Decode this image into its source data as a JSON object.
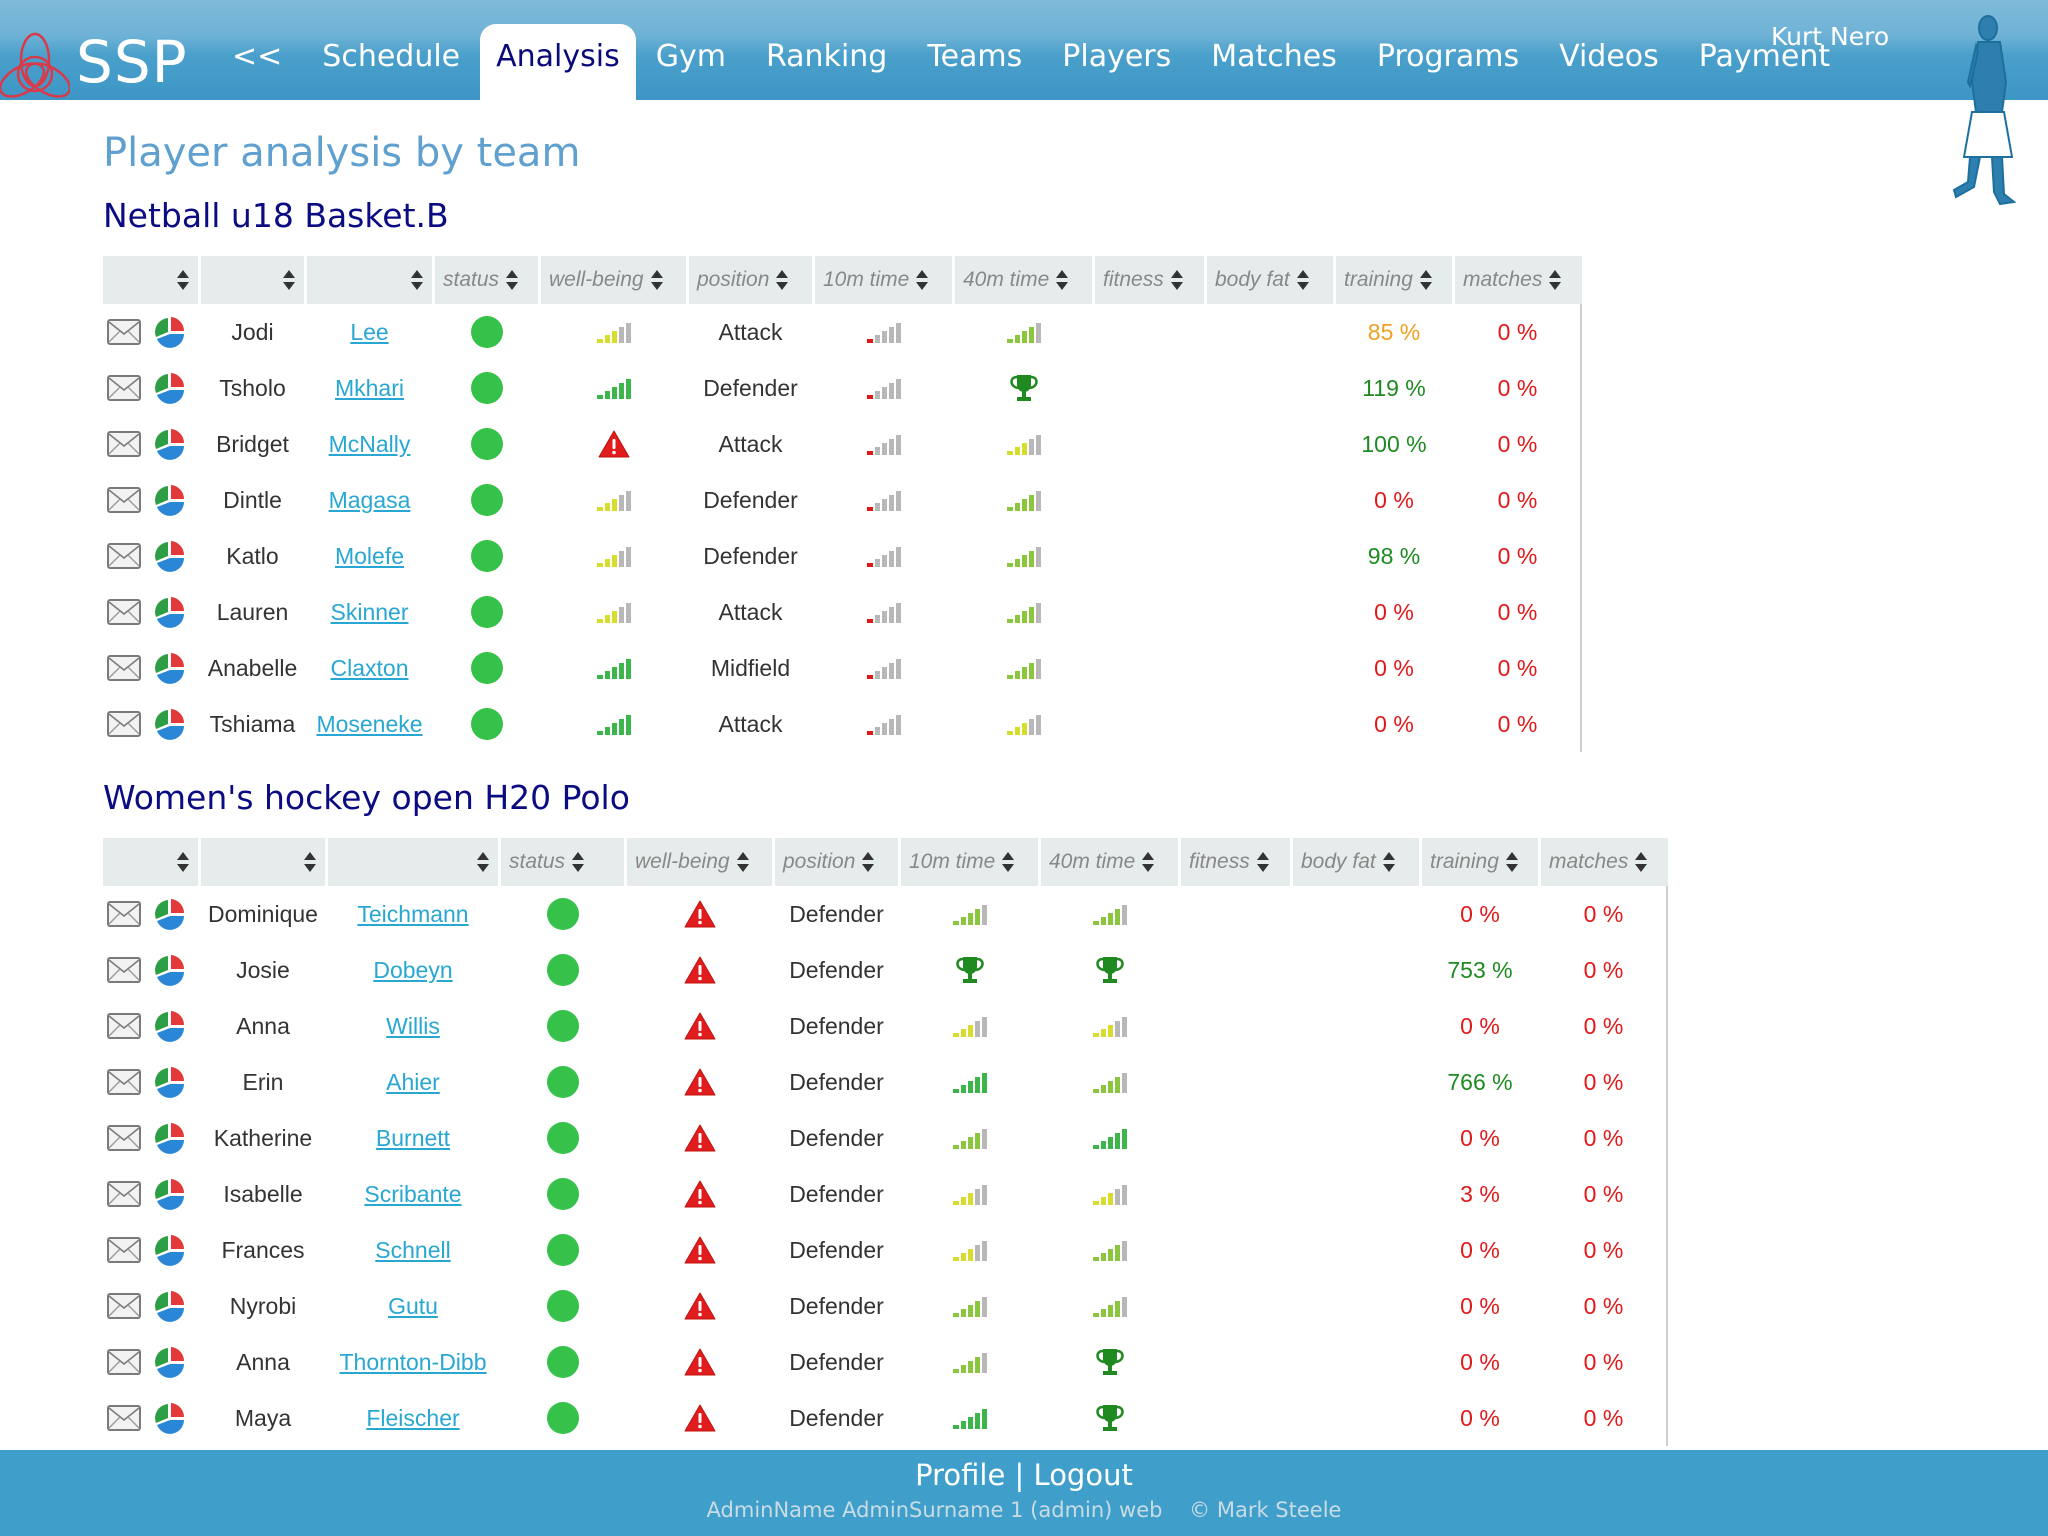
{
  "header": {
    "logo_text": "SSP",
    "back_label": "<<",
    "nav": [
      {
        "label": "Schedule",
        "active": false
      },
      {
        "label": "Analysis",
        "active": true
      },
      {
        "label": "Gym",
        "active": false
      },
      {
        "label": "Ranking",
        "active": false
      },
      {
        "label": "Teams",
        "active": false
      },
      {
        "label": "Players",
        "active": false
      },
      {
        "label": "Matches",
        "active": false
      },
      {
        "label": "Programs",
        "active": false
      },
      {
        "label": "Videos",
        "active": false
      },
      {
        "label": "Payment",
        "active": false
      }
    ],
    "user_name": "Kurt Nero"
  },
  "page_title": "Player analysis by team",
  "columns": [
    "",
    "",
    "",
    "status",
    "well-being",
    "position",
    "10m time",
    "40m time",
    "fitness",
    "body fat",
    "training",
    "matches"
  ],
  "colors": {
    "status_green": "#36c24a",
    "training_orange": "#f0a020",
    "training_green": "#1f8a1f",
    "pct_red": "#e01818",
    "link_blue": "#28a7d2",
    "title_blue": "#5fa0cf",
    "team_title_navy": "#0b0b82"
  },
  "teams": [
    {
      "name": "Netball u18 Basket.B",
      "players": [
        {
          "first": "Jodi",
          "last": "Lee",
          "status": "green",
          "wellbeing": {
            "type": "signal",
            "level": 3,
            "tone": "yellow"
          },
          "position": "Attack",
          "t10": {
            "type": "signal",
            "level": 1,
            "tone": "red"
          },
          "t40": {
            "type": "signal",
            "level": 4,
            "tone": "lightgreen"
          },
          "fitness": "",
          "bodyfat": "",
          "training": "85 %",
          "training_tone": "orange",
          "matches": "0 %"
        },
        {
          "first": "Tsholo",
          "last": "Mkhari",
          "status": "green",
          "wellbeing": {
            "type": "signal",
            "level": 5,
            "tone": "green"
          },
          "position": "Defender",
          "t10": {
            "type": "signal",
            "level": 1,
            "tone": "red"
          },
          "t40": {
            "type": "trophy"
          },
          "fitness": "",
          "bodyfat": "",
          "training": "119 %",
          "training_tone": "green",
          "matches": "0 %"
        },
        {
          "first": "Bridget",
          "last": "McNally",
          "status": "green",
          "wellbeing": {
            "type": "warning"
          },
          "position": "Attack",
          "t10": {
            "type": "signal",
            "level": 1,
            "tone": "red"
          },
          "t40": {
            "type": "signal",
            "level": 3,
            "tone": "yellow"
          },
          "fitness": "",
          "bodyfat": "",
          "training": "100 %",
          "training_tone": "green",
          "matches": "0 %"
        },
        {
          "first": "Dintle",
          "last": "Magasa",
          "status": "green",
          "wellbeing": {
            "type": "signal",
            "level": 3,
            "tone": "yellow"
          },
          "position": "Defender",
          "t10": {
            "type": "signal",
            "level": 1,
            "tone": "red"
          },
          "t40": {
            "type": "signal",
            "level": 4,
            "tone": "lightgreen"
          },
          "fitness": "",
          "bodyfat": "",
          "training": "0 %",
          "training_tone": "red",
          "matches": "0 %"
        },
        {
          "first": "Katlo",
          "last": "Molefe",
          "status": "green",
          "wellbeing": {
            "type": "signal",
            "level": 3,
            "tone": "yellow"
          },
          "position": "Defender",
          "t10": {
            "type": "signal",
            "level": 1,
            "tone": "red"
          },
          "t40": {
            "type": "signal",
            "level": 4,
            "tone": "lightgreen"
          },
          "fitness": "",
          "bodyfat": "",
          "training": "98 %",
          "training_tone": "green",
          "matches": "0 %"
        },
        {
          "first": "Lauren",
          "last": "Skinner",
          "status": "green",
          "wellbeing": {
            "type": "signal",
            "level": 3,
            "tone": "yellow"
          },
          "position": "Attack",
          "t10": {
            "type": "signal",
            "level": 1,
            "tone": "red"
          },
          "t40": {
            "type": "signal",
            "level": 4,
            "tone": "lightgreen"
          },
          "fitness": "",
          "bodyfat": "",
          "training": "0 %",
          "training_tone": "red",
          "matches": "0 %"
        },
        {
          "first": "Anabelle",
          "last": "Claxton",
          "status": "green",
          "wellbeing": {
            "type": "signal",
            "level": 5,
            "tone": "green"
          },
          "position": "Midfield",
          "t10": {
            "type": "signal",
            "level": 1,
            "tone": "red"
          },
          "t40": {
            "type": "signal",
            "level": 4,
            "tone": "lightgreen"
          },
          "fitness": "",
          "bodyfat": "",
          "training": "0 %",
          "training_tone": "red",
          "matches": "0 %"
        },
        {
          "first": "Tshiama",
          "last": "Moseneke",
          "status": "green",
          "wellbeing": {
            "type": "signal",
            "level": 5,
            "tone": "green"
          },
          "position": "Attack",
          "t10": {
            "type": "signal",
            "level": 1,
            "tone": "red"
          },
          "t40": {
            "type": "signal",
            "level": 3,
            "tone": "yellow"
          },
          "fitness": "",
          "bodyfat": "",
          "training": "0 %",
          "training_tone": "red",
          "matches": "0 %"
        }
      ]
    },
    {
      "name": "Women's hockey open H20 Polo",
      "players": [
        {
          "first": "Dominique",
          "last": "Teichmann",
          "status": "green",
          "wellbeing": {
            "type": "warning"
          },
          "position": "Defender",
          "t10": {
            "type": "signal",
            "level": 4,
            "tone": "lightgreen"
          },
          "t40": {
            "type": "signal",
            "level": 4,
            "tone": "lightgreen"
          },
          "fitness": "",
          "bodyfat": "",
          "training": "0 %",
          "training_tone": "red",
          "matches": "0 %"
        },
        {
          "first": "Josie",
          "last": "Dobeyn",
          "status": "green",
          "wellbeing": {
            "type": "warning"
          },
          "position": "Defender",
          "t10": {
            "type": "trophy"
          },
          "t40": {
            "type": "trophy"
          },
          "fitness": "",
          "bodyfat": "",
          "training": "753 %",
          "training_tone": "green",
          "matches": "0 %"
        },
        {
          "first": "Anna",
          "last": "Willis",
          "status": "green",
          "wellbeing": {
            "type": "warning"
          },
          "position": "Defender",
          "t10": {
            "type": "signal",
            "level": 3,
            "tone": "yellow"
          },
          "t40": {
            "type": "signal",
            "level": 3,
            "tone": "yellow"
          },
          "fitness": "",
          "bodyfat": "",
          "training": "0 %",
          "training_tone": "red",
          "matches": "0 %"
        },
        {
          "first": "Erin",
          "last": "Ahier",
          "status": "green",
          "wellbeing": {
            "type": "warning"
          },
          "position": "Defender",
          "t10": {
            "type": "signal",
            "level": 5,
            "tone": "green"
          },
          "t40": {
            "type": "signal",
            "level": 4,
            "tone": "lightgreen"
          },
          "fitness": "",
          "bodyfat": "",
          "training": "766 %",
          "training_tone": "green",
          "matches": "0 %"
        },
        {
          "first": "Katherine",
          "last": "Burnett",
          "status": "green",
          "wellbeing": {
            "type": "warning"
          },
          "position": "Defender",
          "t10": {
            "type": "signal",
            "level": 4,
            "tone": "lightgreen"
          },
          "t40": {
            "type": "signal",
            "level": 5,
            "tone": "green"
          },
          "fitness": "",
          "bodyfat": "",
          "training": "0 %",
          "training_tone": "red",
          "matches": "0 %"
        },
        {
          "first": "Isabelle",
          "last": "Scribante",
          "status": "green",
          "wellbeing": {
            "type": "warning"
          },
          "position": "Defender",
          "t10": {
            "type": "signal",
            "level": 3,
            "tone": "yellow"
          },
          "t40": {
            "type": "signal",
            "level": 3,
            "tone": "yellow"
          },
          "fitness": "",
          "bodyfat": "",
          "training": "3 %",
          "training_tone": "red",
          "matches": "0 %"
        },
        {
          "first": "Frances",
          "last": "Schnell",
          "status": "green",
          "wellbeing": {
            "type": "warning"
          },
          "position": "Defender",
          "t10": {
            "type": "signal",
            "level": 3,
            "tone": "yellow"
          },
          "t40": {
            "type": "signal",
            "level": 4,
            "tone": "lightgreen"
          },
          "fitness": "",
          "bodyfat": "",
          "training": "0 %",
          "training_tone": "red",
          "matches": "0 %"
        },
        {
          "first": "Nyrobi",
          "last": "Gutu",
          "status": "green",
          "wellbeing": {
            "type": "warning"
          },
          "position": "Defender",
          "t10": {
            "type": "signal",
            "level": 4,
            "tone": "lightgreen"
          },
          "t40": {
            "type": "signal",
            "level": 4,
            "tone": "lightgreen"
          },
          "fitness": "",
          "bodyfat": "",
          "training": "0 %",
          "training_tone": "red",
          "matches": "0 %"
        },
        {
          "first": "Anna",
          "last": "Thornton-Dibb",
          "status": "green",
          "wellbeing": {
            "type": "warning"
          },
          "position": "Defender",
          "t10": {
            "type": "signal",
            "level": 4,
            "tone": "lightgreen"
          },
          "t40": {
            "type": "trophy"
          },
          "fitness": "",
          "bodyfat": "",
          "training": "0 %",
          "training_tone": "red",
          "matches": "0 %"
        },
        {
          "first": "Maya",
          "last": "Fleischer",
          "status": "green",
          "wellbeing": {
            "type": "warning"
          },
          "position": "Defender",
          "t10": {
            "type": "signal",
            "level": 5,
            "tone": "green"
          },
          "t40": {
            "type": "trophy"
          },
          "fitness": "",
          "bodyfat": "",
          "training": "0 %",
          "training_tone": "red",
          "matches": "0 %"
        }
      ]
    }
  ],
  "footer": {
    "profile_label": "Profile",
    "separator": "|",
    "logout_label": "Logout",
    "account_info": "AdminName AdminSurname 1 (admin) web",
    "copyright": "© Mark Steele"
  }
}
